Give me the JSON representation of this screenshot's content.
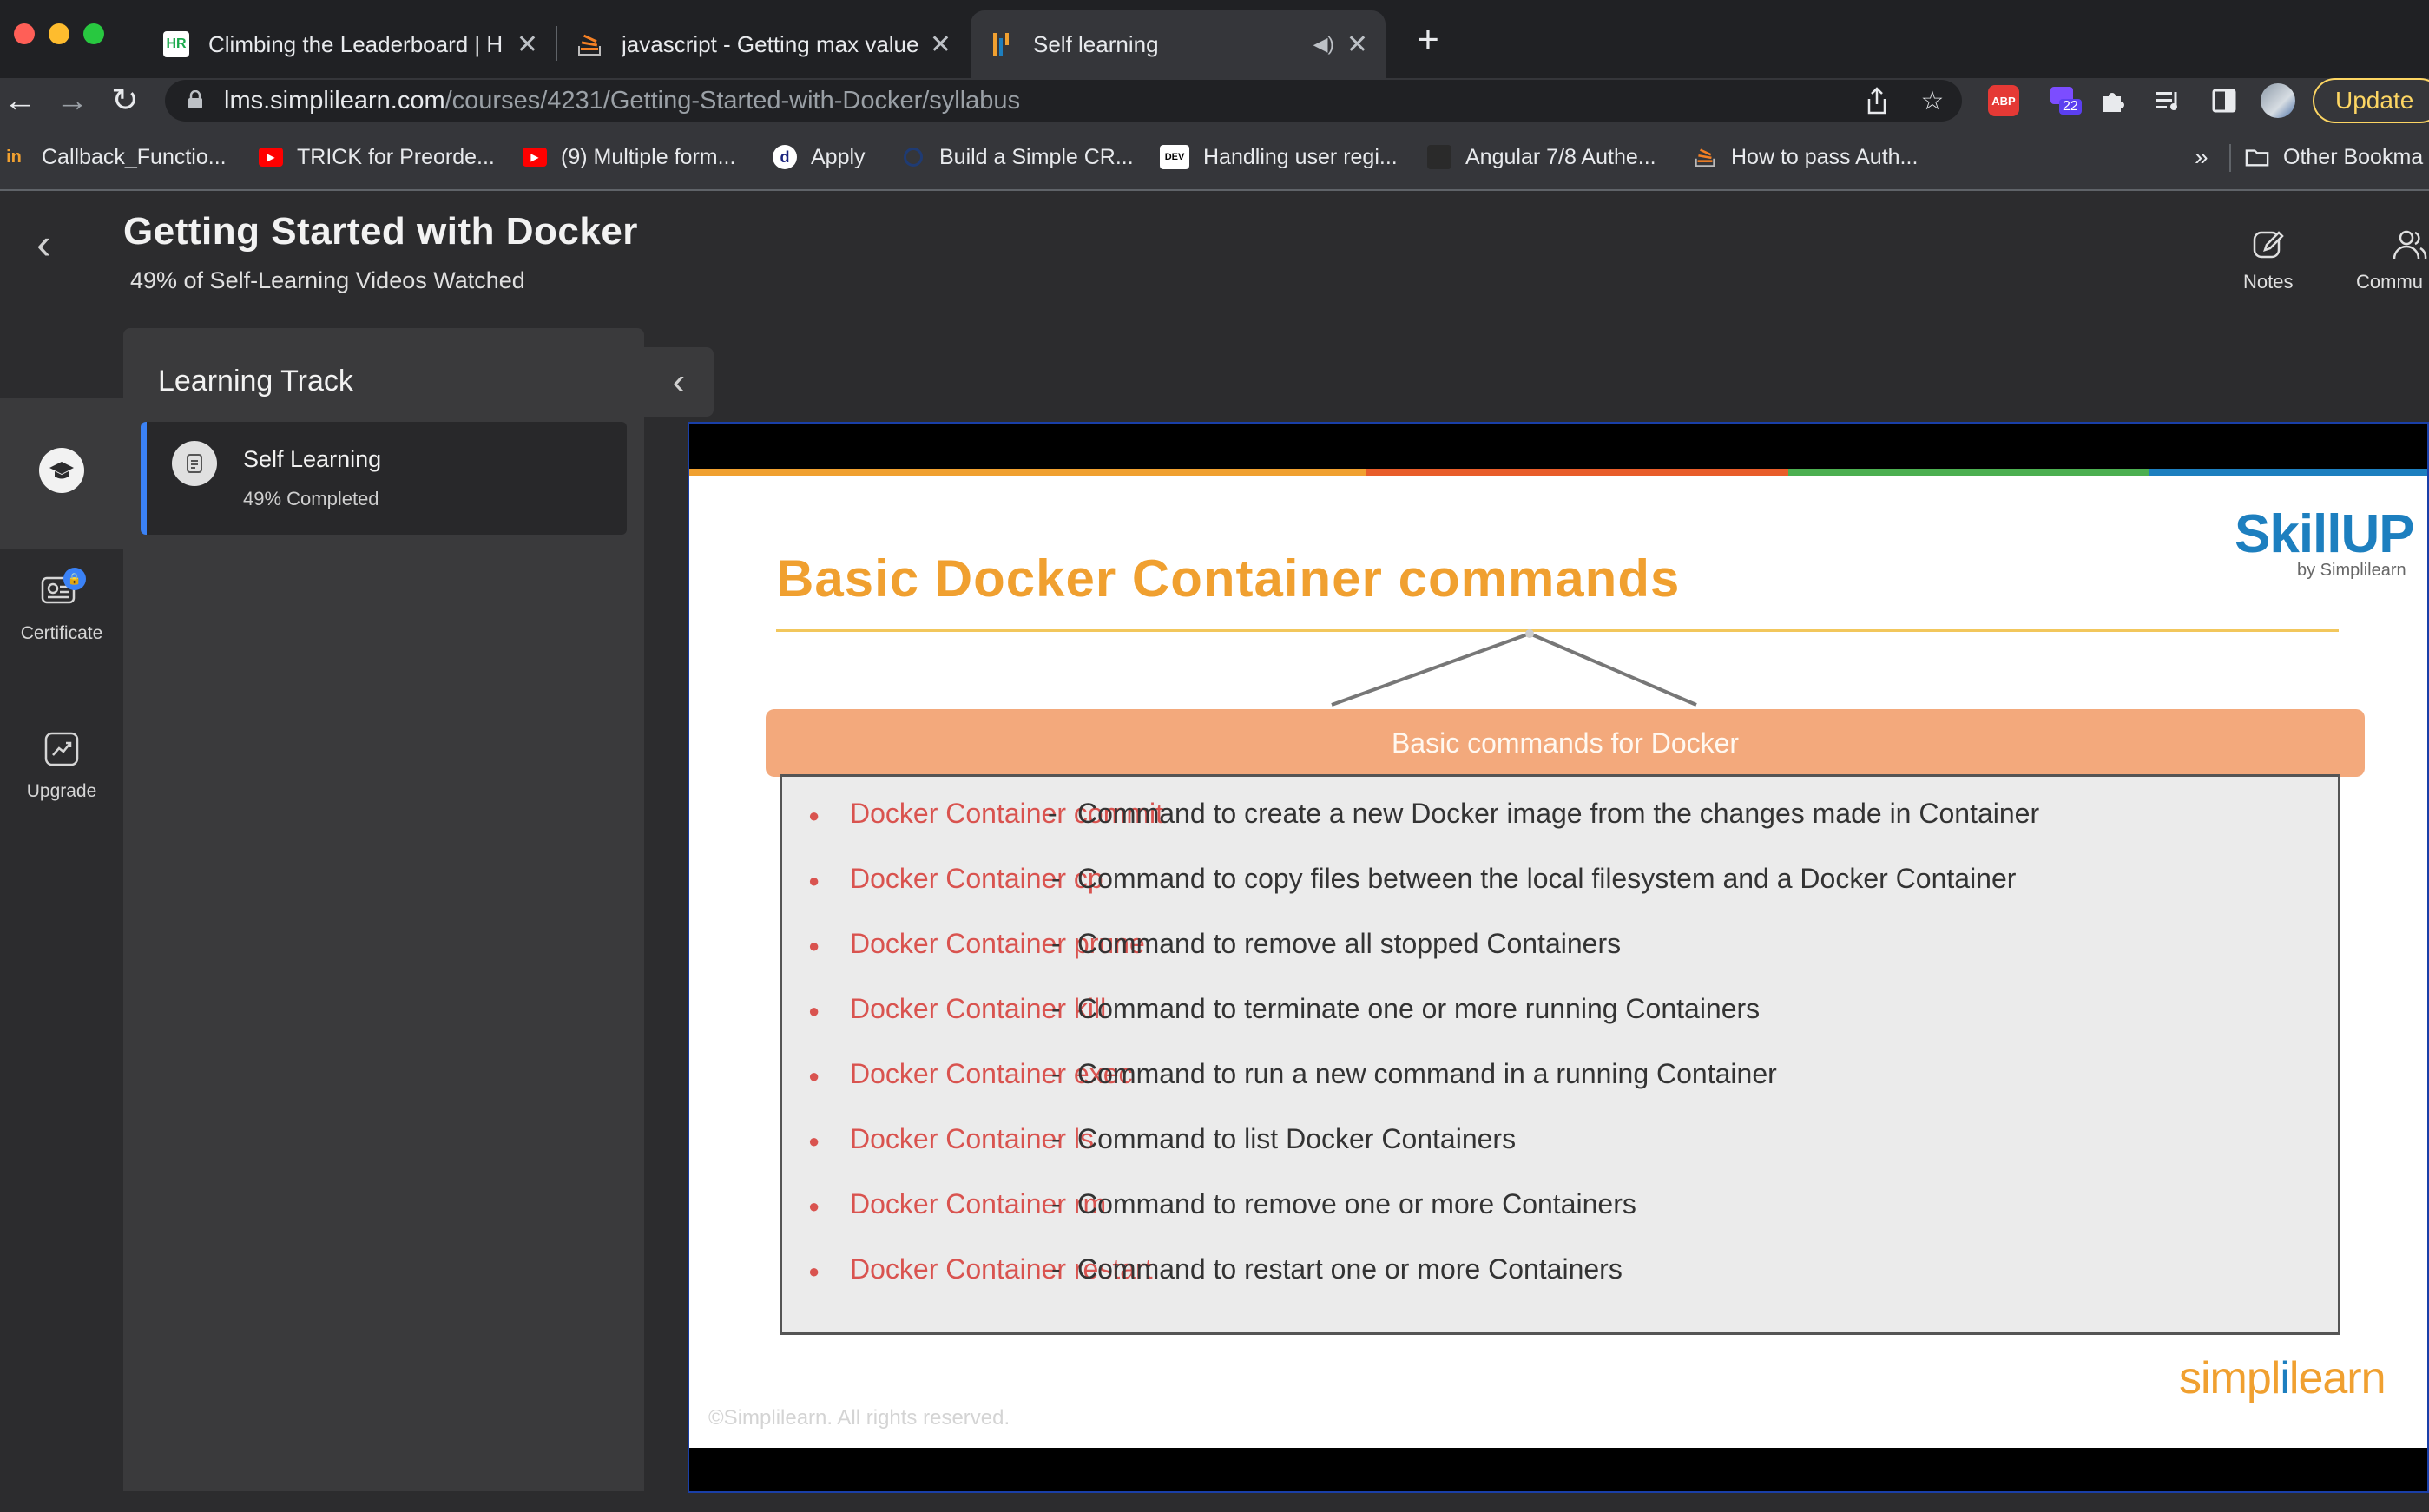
{
  "tabs": [
    {
      "title": "Climbing the Leaderboard | Hac",
      "favicon": "HR"
    },
    {
      "title": "javascript - Getting max value(",
      "favicon": "stackoverflow-icon"
    },
    {
      "title": "Self learning",
      "favicon": "simplilearn-icon"
    }
  ],
  "address": {
    "host": "lms.simplilearn.com",
    "path": "/courses/4231/Getting-Started-with-Docker/syllabus"
  },
  "extensions": {
    "abp_label": "ABP",
    "badge_count": "22"
  },
  "update_label": "Update",
  "bookmarks": [
    {
      "label": "Callback_Functio...",
      "icon": "in"
    },
    {
      "label": "TRICK for Preorde...",
      "icon": "youtube-icon"
    },
    {
      "label": "(9) Multiple form...",
      "icon": "youtube-icon"
    },
    {
      "label": "Apply",
      "icon": "d"
    },
    {
      "label": "Build a Simple CR...",
      "icon": "circle-icon"
    },
    {
      "label": "Handling user regi...",
      "icon": "DEV"
    },
    {
      "label": "Angular 7/8 Authe...",
      "icon": "grid-icon"
    },
    {
      "label": "How to pass Auth...",
      "icon": "stackoverflow-icon"
    }
  ],
  "bookmarks_more": "»",
  "other_bookmarks": "Other Bookma",
  "course": {
    "title": "Getting Started with Docker",
    "subtitle": "49% of Self-Learning Videos Watched"
  },
  "header_tools": {
    "notes": "Notes",
    "community": "Commu"
  },
  "rail": {
    "certificate": "Certificate",
    "upgrade": "Upgrade"
  },
  "track": {
    "title": "Learning Track",
    "item_name": "Self Learning",
    "item_progress": "49% Completed"
  },
  "slide": {
    "title": "Basic Docker Container commands",
    "brand": "SkillUP",
    "brand_by": "by Simplilearn",
    "header": "Basic commands for Docker",
    "commands": [
      {
        "name": "Docker Container commit",
        "desc": "Command to create a new Docker image from the changes made in Container"
      },
      {
        "name": "Docker Container cp",
        "desc": "Command to copy files between the local filesystem and a Docker Container"
      },
      {
        "name": "Docker Container prune",
        "desc": "Command to remove all stopped Containers"
      },
      {
        "name": "Docker Container kill",
        "desc": "Command to terminate one or more running Containers"
      },
      {
        "name": "Docker Container exec",
        "desc": "Command to run a new command in a running Container"
      },
      {
        "name": "Docker Container ls",
        "desc": "Command to list Docker Containers"
      },
      {
        "name": "Docker Container rm",
        "desc": "Command to remove one or more Containers"
      },
      {
        "name": "Docker Container restart",
        "desc": "Command to restart one or more Containers"
      }
    ],
    "logo_left": "simpl",
    "logo_mid": "i",
    "logo_right": "learn",
    "copyright": "©Simplilearn. All rights reserved."
  },
  "colors": {
    "accent_blue": "#3b82f6",
    "slide_orange": "#f0a030",
    "command_red": "#d9534f",
    "update_yellow": "#fdd663"
  }
}
